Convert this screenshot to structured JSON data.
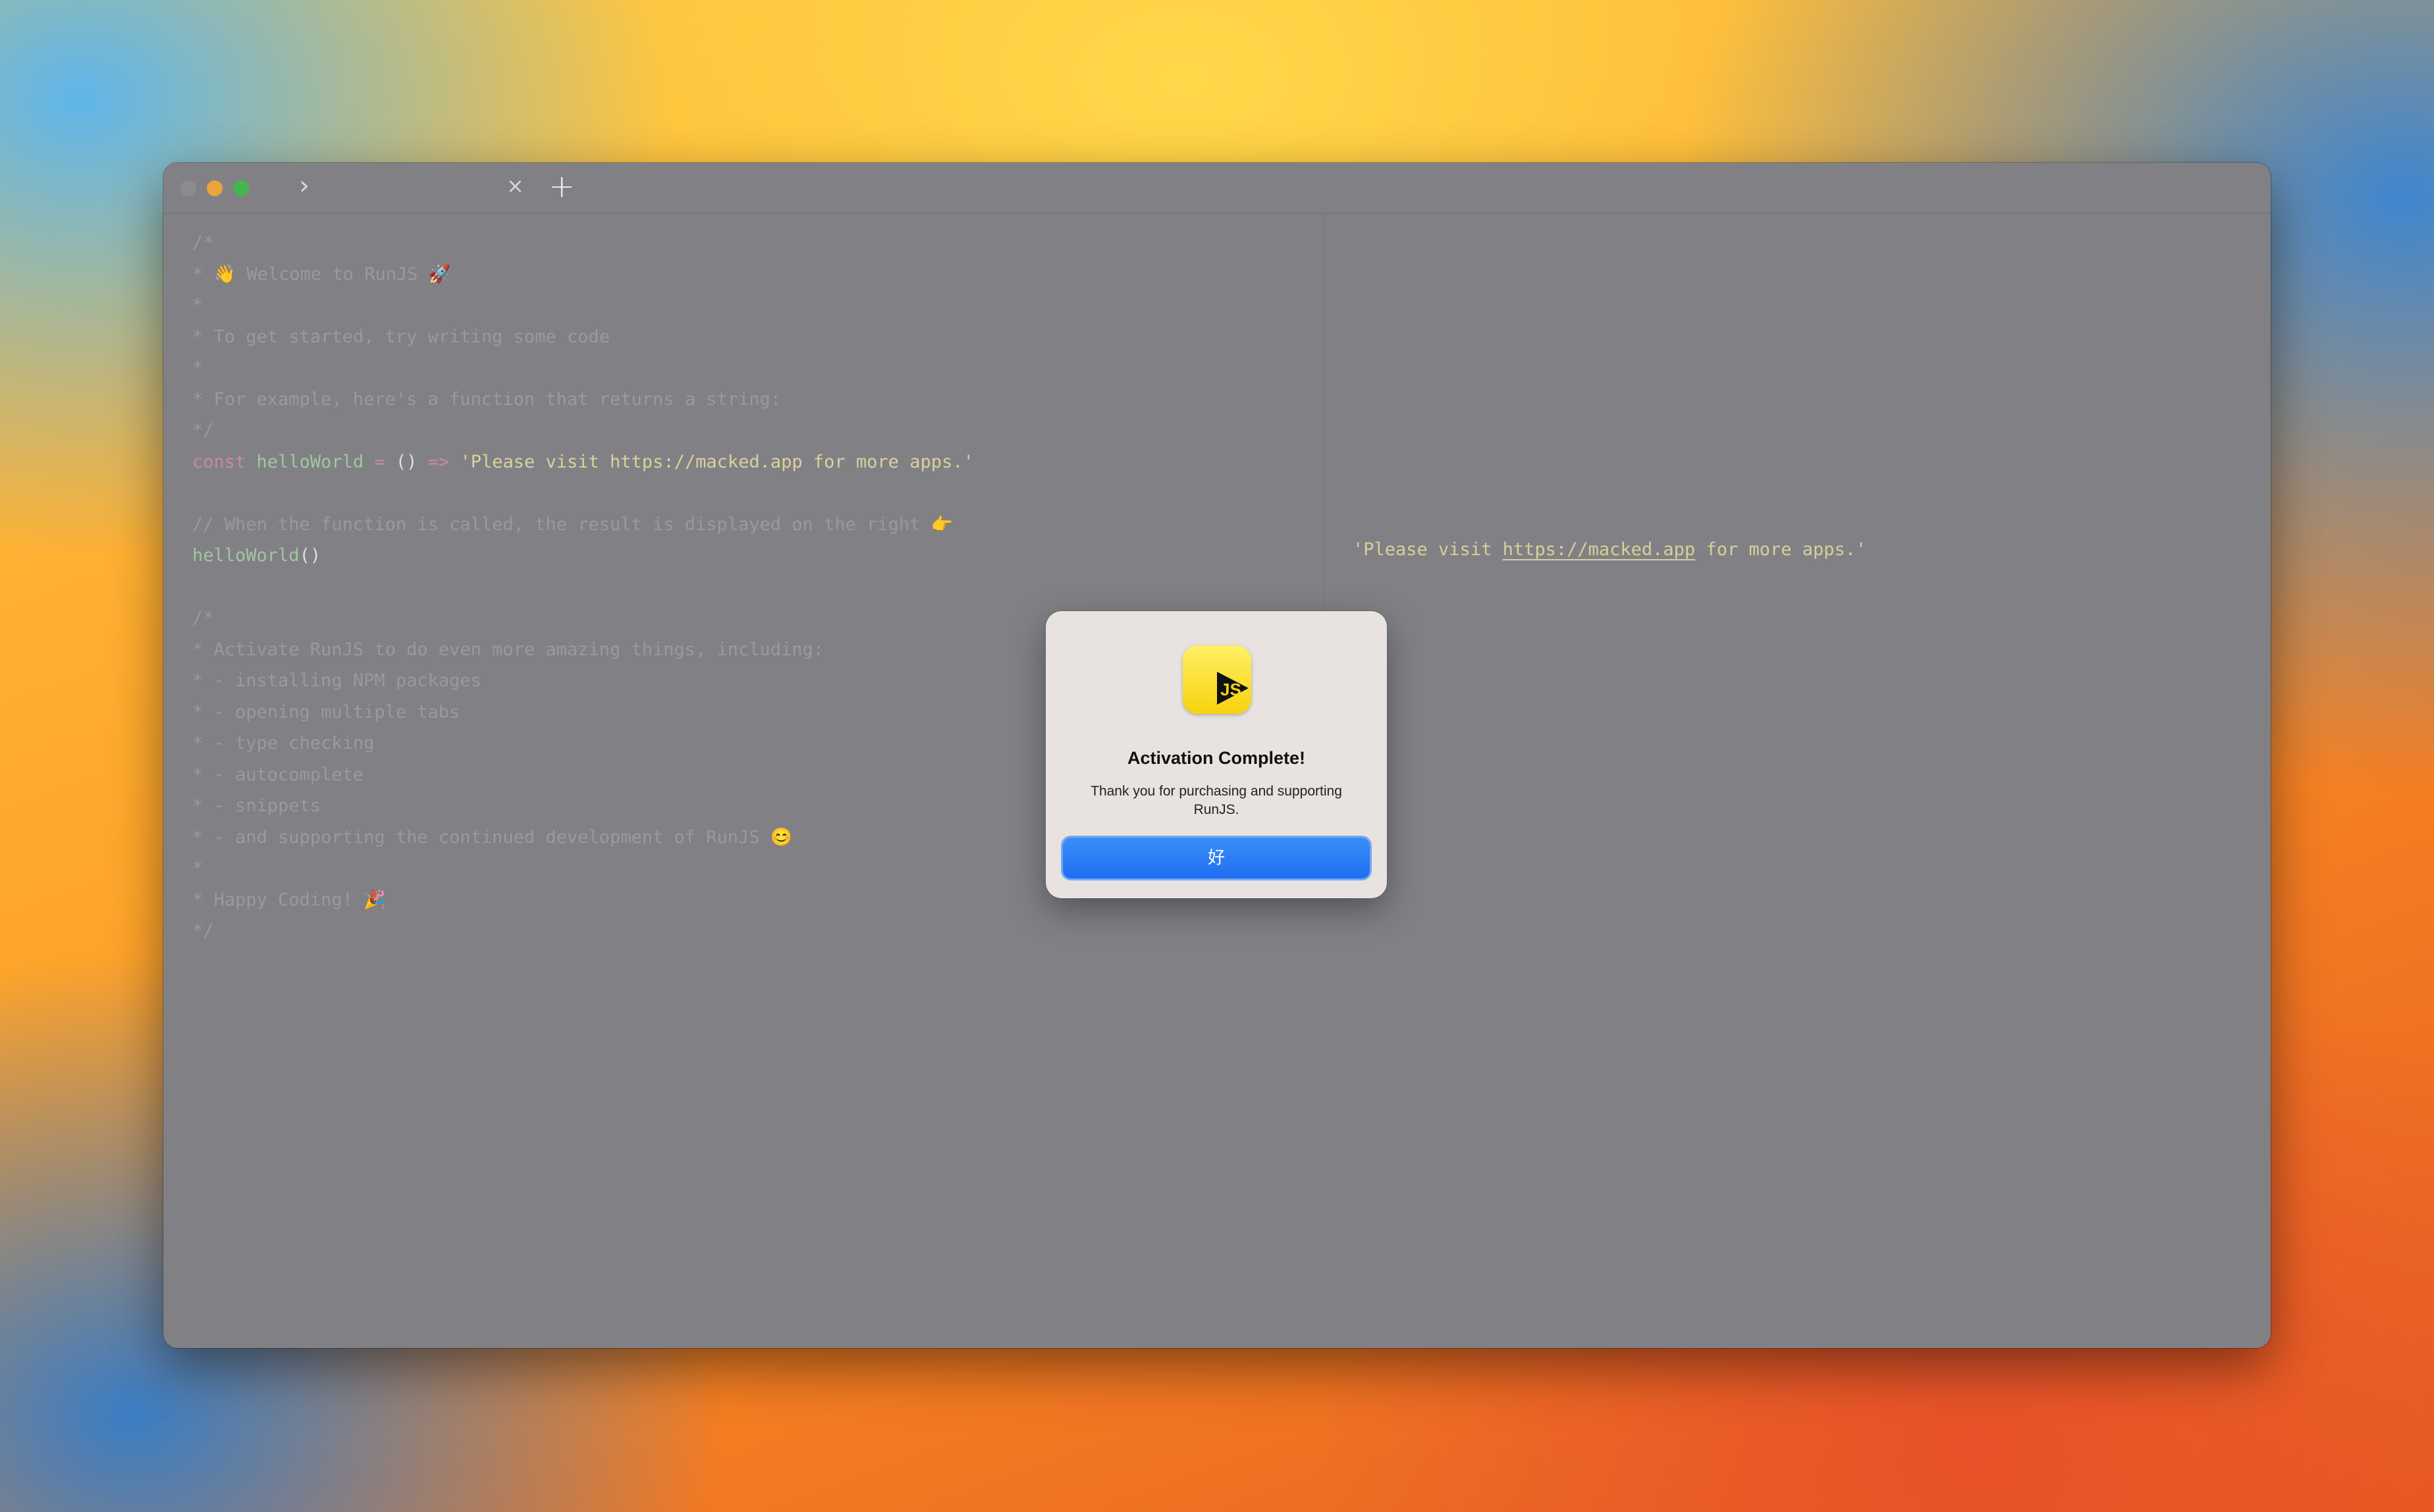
{
  "window": {
    "tab_close": "×",
    "tab_add": "+",
    "chevron": "›"
  },
  "editor": {
    "lines": [
      "/*",
      "* 👋 Welcome to RunJS 🚀",
      "*",
      "* To get started, try writing some code",
      "*",
      "* For example, here's a function that returns a string:",
      "*/",
      "",
      "",
      "// When the function is called, the result is displayed on the right 👉",
      "",
      "",
      "/*",
      "* Activate RunJS to do even more amazing things, including:",
      "* - installing NPM packages",
      "* - opening multiple tabs",
      "* - type checking",
      "* - autocomplete",
      "* - snippets",
      "* - and supporting the continued development of RunJS 😊",
      "*",
      "* Happy Coding! 🎉",
      "*/"
    ],
    "code_line": {
      "kw": "const",
      "name": "helloWorld",
      "eq": "=",
      "parens": "()",
      "arrow": "=>",
      "value": "'Please visit https://macked.app for more apps.'"
    },
    "call_line": {
      "name": "helloWorld",
      "parens": "()"
    }
  },
  "output": {
    "before": "'Please visit ",
    "link": "https://macked.app",
    "after": " for more apps.'"
  },
  "dialog": {
    "title": "Activation Complete!",
    "message": "Thank you for purchasing and supporting RunJS.",
    "ok_label": "好",
    "icon": "runjs-app-icon"
  },
  "colors": {
    "window_bg": "#818085",
    "accent": "#1f6ef2",
    "string": "#d9d29a",
    "keyword": "#c88aa0",
    "function": "#9fc79f",
    "comment": "#9a999e"
  }
}
